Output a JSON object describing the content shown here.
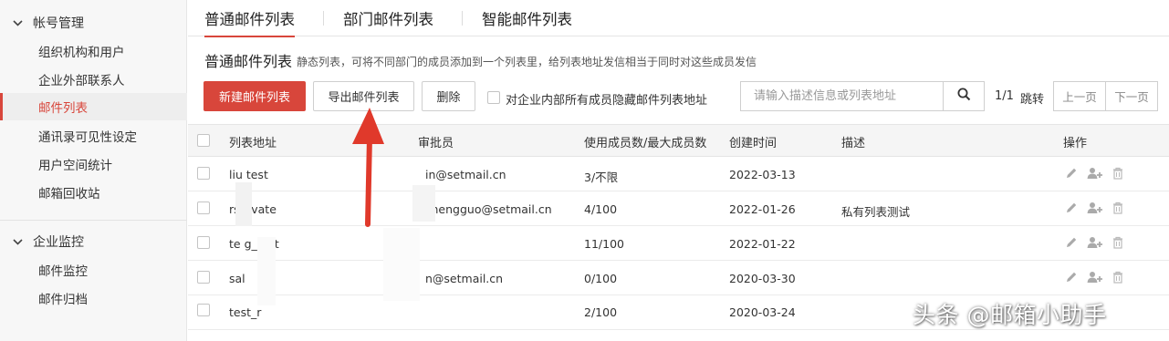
{
  "sidebar": {
    "groups": [
      {
        "label": "帐号管理",
        "items": [
          "组织机构和用户",
          "企业外部联系人",
          "邮件列表",
          "通讯录可见性设定",
          "用户空间统计",
          "邮箱回收站"
        ]
      },
      {
        "label": "企业监控",
        "items": [
          "邮件监控",
          "邮件归档"
        ]
      }
    ],
    "active_item": "邮件列表"
  },
  "tabs": [
    "普通邮件列表",
    "部门邮件列表",
    "智能邮件列表"
  ],
  "page": {
    "title": "普通邮件列表",
    "description": "静态列表，可将不同部门的成员添加到一个列表里，给列表地址发信相当于同时对这些成员发信"
  },
  "toolbar": {
    "new_label": "新建邮件列表",
    "export_label": "导出邮件列表",
    "delete_label": "删除",
    "hide_label": "对企业内部所有成员隐藏邮件列表地址",
    "search_placeholder": "请输入描述信息或列表地址"
  },
  "pager": {
    "page_info": "1/1",
    "jump_label": "跳转",
    "prev_label": "上一页",
    "next_label": "下一页"
  },
  "table": {
    "columns": [
      "列表地址",
      "审批员",
      "使用成员数/最大成员数",
      "创建时间",
      "描述",
      "操作"
    ],
    "rows": [
      {
        "address": "liu  test",
        "approver": "in@setmail.cn",
        "members": "3/不限",
        "created": "2022-03-13",
        "desc": ""
      },
      {
        "address": "rs  rivate",
        "approver": "shengguo@setmail.cn",
        "members": "4/100",
        "created": "2022-01-26",
        "desc": "私有列表测试"
      },
      {
        "address": "te   g_test",
        "approver": "",
        "members": "11/100",
        "created": "2022-01-22",
        "desc": ""
      },
      {
        "address": "sal",
        "approver": "n@setmail.cn",
        "members": "0/100",
        "created": "2020-03-30",
        "desc": ""
      },
      {
        "address": "test_r",
        "approver": "",
        "members": "2/100",
        "created": "2020-03-24",
        "desc": ""
      }
    ]
  },
  "watermark": "头条 @邮箱小助手",
  "colors": {
    "accent": "#d8463b",
    "annotation_arrow": "#e0392b"
  },
  "icons": {
    "row_actions": [
      "pencil-icon",
      "add-user-icon",
      "trash-icon"
    ],
    "search": "search-icon",
    "group_toggle": "chevron-down-icon"
  }
}
